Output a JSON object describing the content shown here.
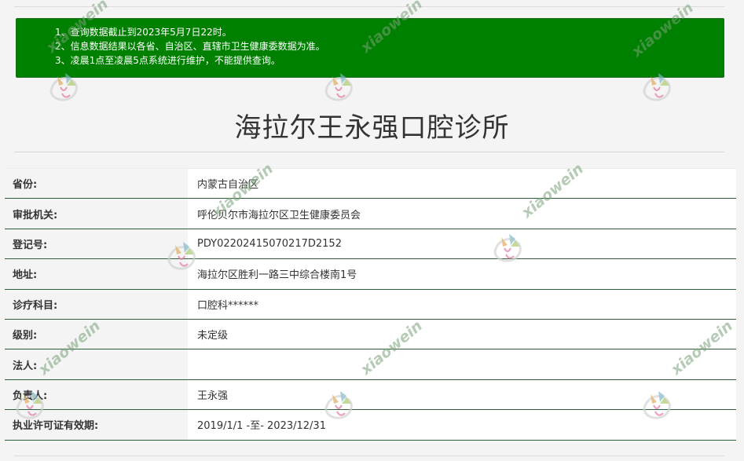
{
  "notice": {
    "items": [
      "1、查询数据截止到2023年5月7日22时。",
      "2、信息数据结果以各省、自治区、直辖市卫生健康委数据为准。",
      "3、凌晨1点至凌晨5点系统进行维护，不能提供查询。"
    ]
  },
  "page_title": "海拉尔王永强口腔诊所",
  "fields": [
    {
      "label": "省份:",
      "value": "内蒙古自治区"
    },
    {
      "label": "审批机关:",
      "value": "呼伦贝尔市海拉尔区卫生健康委员会"
    },
    {
      "label": "登记号:",
      "value": "PDY02202415070217D2152"
    },
    {
      "label": "地址:",
      "value": "海拉尔区胜利一路三中综合楼南1号"
    },
    {
      "label": "诊疗科目:",
      "value": "口腔科******"
    },
    {
      "label": "级别:",
      "value": "未定级"
    },
    {
      "label": "法人:",
      "value": ""
    },
    {
      "label": "负责人:",
      "value": "王永强"
    },
    {
      "label": "执业许可证有效期:",
      "value": "2019/1/1 -至- 2023/12/31"
    }
  ],
  "watermark": {
    "brand_latin": "xiaowein",
    "brand_cn": "开立特口腔",
    "brand_sub": "kelete.com"
  },
  "colors": {
    "notice_bg": "#008000",
    "row_divider": "#2d5e3c"
  }
}
